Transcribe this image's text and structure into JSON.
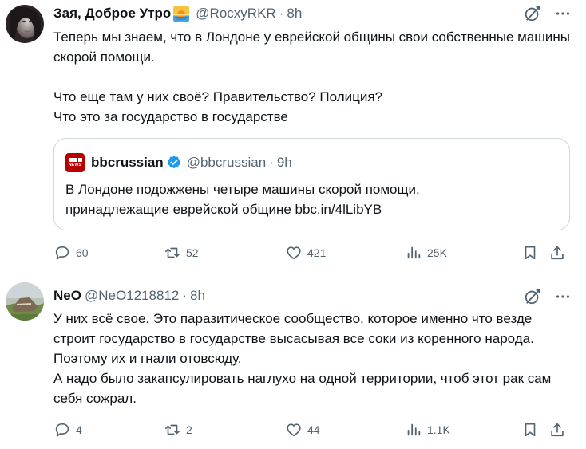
{
  "tweets": [
    {
      "author_name": "Зая, Доброе Утро",
      "author_handle": "@RocxyRKR",
      "separator": "·",
      "time": "8h",
      "text_paragraphs": [
        "Теперь мы знаем, что в Лондоне у еврейской общины свои собственные машины скорой помощи.",
        "",
        "Что еще там у них своё? Правительство? Полиция?",
        "Что это за государство в государстве"
      ],
      "quote": {
        "author_name": "bbcrussian",
        "author_handle": "@bbcrussian",
        "separator": "·",
        "time": "9h",
        "logo_text": "NEWS",
        "text_line1": "В Лондоне подожжены четыре машины скорой помощи,",
        "text_line2": "принадлежащие еврейской общине bbc.in/4lLibYB"
      },
      "stats": {
        "replies": "60",
        "retweets": "52",
        "likes": "421",
        "views": "25K"
      }
    },
    {
      "author_name": "NeO",
      "author_handle": "@NeO1218812",
      "separator": "·",
      "time": "8h",
      "text_paragraphs": [
        "У них всё свое. Это паразитическое сообщество, которое именно что везде строит государство в государстве высасывая все соки из коренного народа. Поэтому их и гнали отовсюду.",
        "А надо было закапсулировать наглухо на одной территории, чтоб этот рак сам себя сожрал."
      ],
      "stats": {
        "replies": "4",
        "retweets": "2",
        "likes": "44",
        "views": "1.1K"
      }
    }
  ],
  "colors": {
    "text": "#0f1419",
    "secondary": "#536471",
    "verified": "#1d9bf0",
    "bbc_red": "#b80000",
    "border": "#cfd9de"
  },
  "icons": [
    "grok-icon",
    "more-icon",
    "verified-icon",
    "reply-icon",
    "retweet-icon",
    "like-icon",
    "views-icon",
    "bookmark-icon",
    "share-icon"
  ]
}
